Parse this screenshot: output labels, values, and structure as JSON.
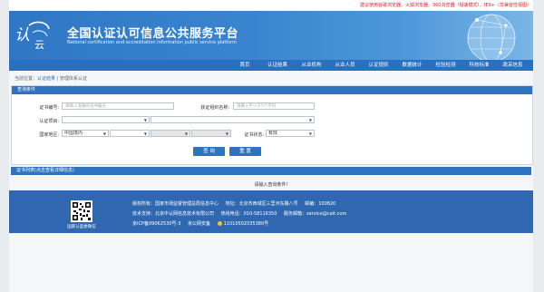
{
  "notice": "建议使用谷歌浏览器、火狐浏览器、360浏览器（极速模式）、IE9+（非兼容性视图）",
  "header": {
    "logo_text": "认证云",
    "title": "全国认证认可信息公共服务平台",
    "subtitle": "National certification and accreditation information public service platform"
  },
  "nav": {
    "items": [
      "首页",
      "认证结果",
      "从业机构",
      "从业人员",
      "认证规则",
      "数据统计",
      "检验检测",
      "科技标准",
      "政采信息"
    ]
  },
  "breadcrumb": {
    "prefix": "当前位置：",
    "link": "认证结果",
    "separator": "|",
    "current": "管理体系认证"
  },
  "search": {
    "header": "查询条件",
    "cert_no_label": "证书编号:",
    "cert_no_placeholder": "请输入准确的证书编号",
    "org_label": "获证组织名称:",
    "org_placeholder": "请输入不少于5个字符",
    "project_label": "认证项目:",
    "region_label": "国家地区:",
    "region_value": "中国境内",
    "status_label": "证书状态:",
    "status_value": "有效",
    "query_label": "查 询",
    "reset_label": "重 置"
  },
  "results": {
    "header": "证书列表(点击查看详细信息)",
    "hint": "请输入查询条件!"
  },
  "footer": {
    "qr_caption": "国家认监委微信",
    "line1": [
      "版权所有：国家市场监督管理总局信息中心",
      "地址：北京市西城区三里河东路八号",
      "邮编：100820"
    ],
    "line2": [
      "技术支持：北京中认网信息技术有限公司",
      "热线电话：010-58116350",
      "服务邮箱：service@cait.com"
    ],
    "line3": [
      "京ICP备09062530号-3",
      "京公网安备",
      "11010502035380号"
    ]
  },
  "colors": {
    "nav_bg": "#2a70c0",
    "panel_header": "#2e73bd",
    "footer_bg": "#2f68b0",
    "notice": "#d9232d"
  }
}
